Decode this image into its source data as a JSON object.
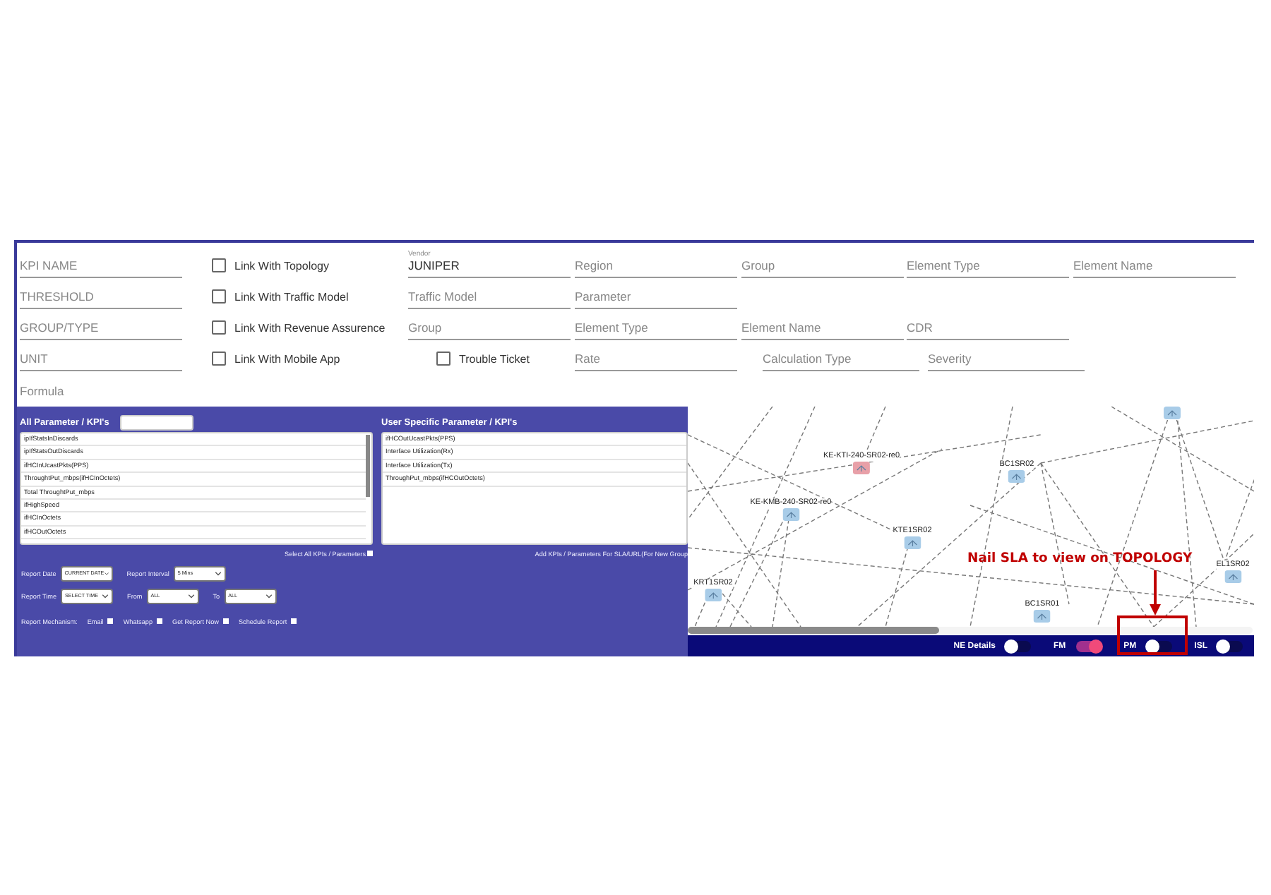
{
  "form": {
    "rows": [
      [
        {
          "kind": "field",
          "placeholder": "KPI NAME"
        },
        {
          "kind": "checkbox",
          "label": "Link With Topology",
          "checked": false
        },
        {
          "kind": "value-field",
          "label": "Vendor",
          "value": "JUNIPER"
        },
        {
          "kind": "field",
          "placeholder": "Region"
        },
        {
          "kind": "field",
          "placeholder": "Group"
        },
        {
          "kind": "field",
          "placeholder": "Element Type"
        },
        {
          "kind": "field",
          "placeholder": "Element Name"
        }
      ],
      [
        {
          "kind": "field",
          "placeholder": "THRESHOLD"
        },
        {
          "kind": "checkbox",
          "label": "Link With Traffic Model",
          "checked": false
        },
        {
          "kind": "field",
          "placeholder": "Traffic Model"
        },
        {
          "kind": "field",
          "placeholder": "Parameter"
        }
      ],
      [
        {
          "kind": "field",
          "placeholder": "GROUP/TYPE"
        },
        {
          "kind": "checkbox",
          "label": "Link With Revenue Assurence",
          "checked": false
        },
        {
          "kind": "field",
          "placeholder": "Group"
        },
        {
          "kind": "field",
          "placeholder": "Element Type"
        },
        {
          "kind": "field",
          "placeholder": "Element Name"
        },
        {
          "kind": "field",
          "placeholder": "CDR"
        }
      ],
      [
        {
          "kind": "field",
          "placeholder": "UNIT"
        },
        {
          "kind": "checkbox",
          "label": "Link With Mobile App",
          "checked": false
        },
        {
          "kind": "checkbox",
          "label": "Trouble Ticket",
          "checked": false
        },
        {
          "kind": "field",
          "placeholder": "Rate"
        },
        {
          "kind": "field",
          "placeholder": "Calculation Type"
        },
        {
          "kind": "field",
          "placeholder": "Severity"
        }
      ],
      [
        {
          "kind": "field",
          "placeholder": "Formula",
          "underline": false
        }
      ]
    ]
  },
  "parameters_panel": {
    "all_title": "All Parameter / KPI's",
    "all_items": [
      "ipIfStatsInDiscards",
      "ipIfStatsOutDiscards",
      "ifHCInUcastPkts(PPS)",
      "ThroughtPut_mbps(ifHCInOctets)",
      "Total ThroughtPut_mbps",
      "ifHighSpeed",
      "ifHCInOctets",
      "ifHCOutOctets"
    ],
    "select_all": {
      "label": "Select All KPIs / Parameters",
      "checked": false
    },
    "user_title": "User Specific Parameter / KPI's",
    "user_items": [
      "ifHCOutUcastPkts(PPS)",
      "Interface Utilization(Rx)",
      "Interface Utilization(Tx)",
      "ThroughPut_mbps(ifHCOutOctets)"
    ],
    "add_link": "Add KPIs / Parameters For SLA/URL(For New Group",
    "report_rows": [
      [
        {
          "label": "Report Date",
          "select": "CURRENT DATE"
        },
        {
          "label": "Report Interval",
          "select": "5 Mins"
        }
      ],
      [
        {
          "label": "Report Time",
          "select": "SELECT TIME"
        },
        {
          "label": "From",
          "select": "ALL"
        },
        {
          "label": "To",
          "select": "ALL"
        }
      ]
    ],
    "mechanism_label": "Report Mechanism:",
    "mechanisms": [
      {
        "label": "Email",
        "checked": false
      },
      {
        "label": "Whatsapp",
        "checked": false
      },
      {
        "label": "Get Report Now",
        "checked": false
      },
      {
        "label": "Schedule Report",
        "checked": false
      }
    ]
  },
  "topology": {
    "nodes": [
      {
        "name": "KE-KTI-240-SR02-re0",
        "color": "#e8a0a8"
      },
      {
        "name": "BC1SR02",
        "color": "#a8cce8"
      },
      {
        "name": "KE-KMB-240-SR02-re0",
        "color": "#a8cce8"
      },
      {
        "name": "KTE1SR02",
        "color": "#a8cce8"
      },
      {
        "name": "KRT1SR02",
        "color": "#a8cce8"
      },
      {
        "name": "BC1SR01",
        "color": "#a8cce8"
      },
      {
        "name": "EL1SR02",
        "color": "#a8cce8"
      },
      {
        "color": "#a8cce8"
      }
    ],
    "toggles": [
      {
        "label": "NE Details",
        "on": false
      },
      {
        "label": "FM",
        "on": true
      },
      {
        "label": "PM",
        "on": false
      },
      {
        "label": "ISL",
        "on": false
      }
    ],
    "annotation": "Nail SLA to view on TOPOLOGY"
  }
}
